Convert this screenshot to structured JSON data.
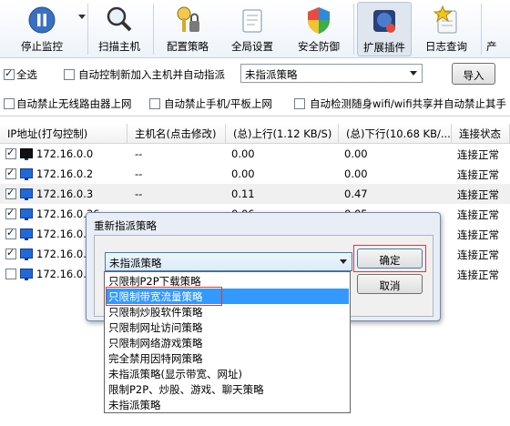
{
  "toolbar": {
    "items": [
      {
        "label": "停止监控",
        "icon": "pause-icon"
      },
      {
        "label": "扫描主机",
        "icon": "magnifier-icon"
      },
      {
        "label": "配置策略",
        "icon": "key-lock-icon"
      },
      {
        "label": "全局设置",
        "icon": "settings-icon"
      },
      {
        "label": "安全防御",
        "icon": "shield-icon"
      },
      {
        "label": "扩展插件",
        "icon": "plugin-icon"
      },
      {
        "label": "日志查询",
        "icon": "log-star-icon"
      },
      {
        "label": "产",
        "icon": "product-icon"
      }
    ]
  },
  "options": {
    "select_all": "全选",
    "auto_control_new_host": "自动控制新加入主机并自动指派",
    "policy_combo_value": "未指派策略",
    "import_button": "导入",
    "auto_block_wireless_router": "自动禁止无线路由器上网",
    "auto_block_phone_tablet": "自动禁止手机/平板上网",
    "auto_detect_portable_wifi": "自动检测随身wifi/wifi共享并自动禁止其手"
  },
  "table": {
    "headers": [
      "IP地址(打勾控制)",
      "主机名(点击修改)",
      "(总)上行(1.12 KB/S)",
      "(总)下行(10.68 KB/...",
      "连接状态"
    ],
    "rows": [
      {
        "ip": "172.16.0.0",
        "host": "--",
        "up": "0.00",
        "down": "0.00",
        "status": "连接正常",
        "checked": true,
        "dark": true
      },
      {
        "ip": "172.16.0.2",
        "host": "--",
        "up": "0.00",
        "down": "0.00",
        "status": "连接正常",
        "checked": true,
        "dark": false
      },
      {
        "ip": "172.16.0.3",
        "host": "--",
        "up": "0.11",
        "down": "0.47",
        "status": "连接正常",
        "checked": true,
        "dark": false
      },
      {
        "ip": "172.16.0.36",
        "host": "--",
        "up": "0.06",
        "down": "0.05",
        "status": "连接正常",
        "checked": true,
        "dark": false
      },
      {
        "ip": "172.16.0.1",
        "host": "--",
        "up": "",
        "down": "",
        "status": "连接正常",
        "checked": true,
        "dark": false
      },
      {
        "ip": "172.16.0.1",
        "host": "--",
        "up": "",
        "down": "",
        "status": "连接正常",
        "checked": true,
        "dark": false
      },
      {
        "ip": "172.16.0.2",
        "host": "--",
        "up": "",
        "down": "",
        "status": "连接正常",
        "checked": false,
        "dark": false
      }
    ]
  },
  "dialog": {
    "title": "重新指派策略",
    "selected_value": "未指派策略",
    "ok_button": "确定",
    "cancel_button": "取消",
    "options": [
      "只限制P2P下载策略",
      "只限制带宽流量策略",
      "只限制炒股软件策略",
      "只限制网址访问策略",
      "只限制网络游戏策略",
      "完全禁用因特网策略",
      "未指派策略(显示带宽、网址)",
      "限制P2P、炒股、游戏、聊天策略",
      "未指派策略"
    ],
    "highlighted_index": 1
  },
  "colors": {
    "selection": "#3399ff",
    "focus_outline": "#d83b3b",
    "monitor_blue": "#1f6bd6"
  }
}
